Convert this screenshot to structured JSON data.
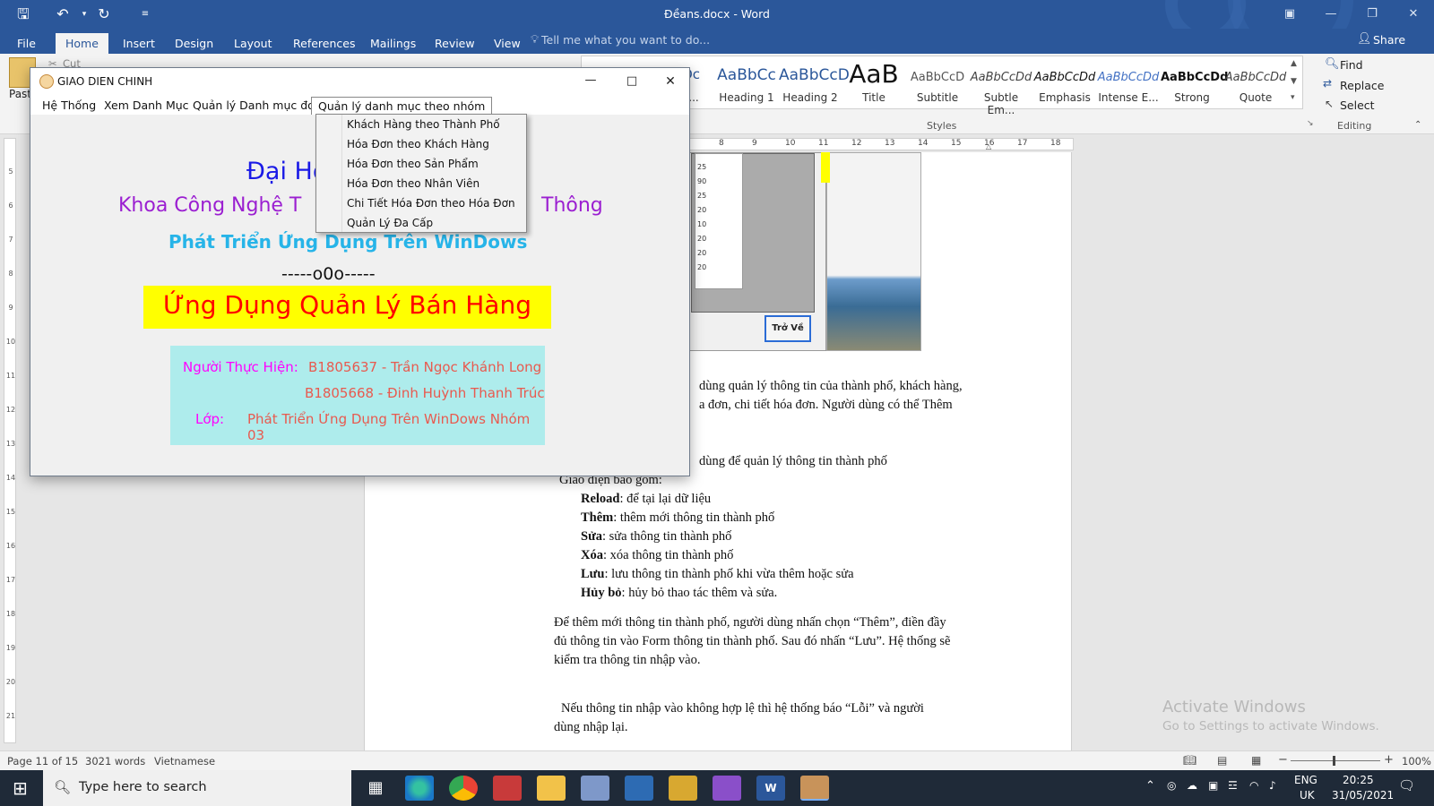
{
  "word": {
    "doc_title": "Đềans.docx - Word",
    "qat": {
      "save_icon": "save-icon",
      "undo_icon": "undo-icon",
      "redo_icon": "redo-icon"
    },
    "tabs": [
      "File",
      "Home",
      "Insert",
      "Design",
      "Layout",
      "References",
      "Mailings",
      "Review",
      "View"
    ],
    "active_tab": "Home",
    "tell_me": "Tell me what you want to do...",
    "share": "Share",
    "clipboard": {
      "cut": "Cut",
      "paste": "Past"
    },
    "styles": [
      {
        "preview": "AaBbCc",
        "label": "Heading 1"
      },
      {
        "preview": "AaBbCcD",
        "label": "Heading 2"
      },
      {
        "preview": "AaB",
        "label": "Title"
      },
      {
        "preview": "AaBbCcD",
        "label": "Subtitle"
      },
      {
        "preview": "AaBbCcDd",
        "label": "Subtle Em..."
      },
      {
        "preview": "AaBbCcDd",
        "label": "Emphasis"
      },
      {
        "preview": "AaBbCcDd",
        "label": "Intense E..."
      },
      {
        "preview": "AaBbCcDd",
        "label": "Strong"
      },
      {
        "preview": "AaBbCcDd",
        "label": "Quote"
      }
    ],
    "styles_partial_preview": "cDc",
    "styles_partial_label": "ac...",
    "styles_group": "Styles",
    "editing": {
      "find": "Find",
      "replace": "Replace",
      "select": "Select",
      "group": "Editing"
    },
    "ruler_numbers": [
      "8",
      "9",
      "10",
      "11",
      "12",
      "13",
      "14",
      "15",
      "16",
      "17",
      "18"
    ],
    "vruler_numbers": [
      "5",
      "6",
      "7",
      "8",
      "9",
      "10",
      "11",
      "12",
      "13",
      "14",
      "15",
      "16",
      "17",
      "18",
      "19",
      "20",
      "21"
    ],
    "embedded_grid_values": [
      "25",
      "90",
      "25",
      "20",
      "10",
      "20",
      "20",
      "20"
    ],
    "embedded_button": "Trở Về",
    "document_lines": [
      "dùng quản lý thông tin của thành phố, khách hàng,",
      "a đơn, chi tiết hóa đơn. Người dùng có thể Thêm",
      "dùng để quản lý thông tin thành phố",
      "Giao diện bao gồm:"
    ],
    "bullets": [
      {
        "term": "Reload",
        "desc": ": để tại lại dữ liệu"
      },
      {
        "term": "Thêm",
        "desc": ": thêm mới thông tin thành phố"
      },
      {
        "term": "Sửa",
        "desc": ": sửa thông tin thành phố"
      },
      {
        "term": "Xóa",
        "desc": ": xóa thông tin thành  phố"
      },
      {
        "term": "Lưu",
        "desc": ": lưu thông tin thành phố khi vừa thêm hoặc sửa"
      },
      {
        "term": "Hủy bỏ",
        "desc": ": hủy bỏ thao tác thêm và sửa."
      }
    ],
    "para1": [
      "Để thêm mới thông tin thành phố, người dùng nhấn chọn “Thêm”,  điền đầy",
      "đủ thông tin vào Form thông tin thành phố. Sau đó nhấn “Lưu”. Hệ thống sẽ",
      "kiểm tra thông tin nhập vào."
    ],
    "para2": [
      "Nếu thông tin nhập vào không hợp lệ thì hệ thống báo “Lỗi” và người",
      "dùng nhập lại."
    ],
    "activate": {
      "title": "Activate Windows",
      "sub": "Go to Settings to activate Windows."
    },
    "status": {
      "page": "Page 11 of 15",
      "words": "3021 words",
      "lang": "Vietnamese",
      "zoom": "100%"
    }
  },
  "app": {
    "title": "GIAO DIEN CHINH",
    "menu": [
      "Hệ Thống",
      "Xem Danh Mục",
      "Quản lý Danh mục đơn",
      "Quản lý danh mục theo nhóm"
    ],
    "dropdown": [
      "Khách Hàng theo Thành Phố",
      "Hóa Đơn theo Khách Hàng",
      "Hóa Đơn theo Sản Phẩm",
      "Hóa Đơn theo Nhân Viên",
      "Chi Tiết Hóa Đơn theo Hóa Đơn",
      "Quản Lý Đa Cấp"
    ],
    "heading1": "Đại Họ",
    "heading2_left": "Khoa Công Nghệ T",
    "heading2_right": "Thông",
    "heading3": "Phát Triển Ứng Dụng Trên WinDows",
    "divider": "-----o0o-----",
    "banner": "Ứng Dụng Quản Lý Bán Hàng",
    "info": {
      "label_performer": "Người Thực Hiện:",
      "member1": "B1805637 - Trần Ngọc Khánh Long",
      "member2": "B1805668 - Đinh Huỳnh Thanh Trúc",
      "label_class": "Lớp:",
      "class_name": "Phát Triển Ứng Dụng Trên WinDows Nhóm 03"
    },
    "colors": {
      "heading1": "#1a1ae6",
      "heading2": "#9b1fd1",
      "heading3": "#27b4e8",
      "banner_bg": "#ffff00",
      "banner_fg": "#ff0000",
      "info_bg": "#aeecec",
      "label": "#ff00ff",
      "value": "#e85a4f"
    }
  },
  "taskbar": {
    "search": "Type here to search",
    "lang": "ENG",
    "region": "UK",
    "time": "20:25",
    "date": "31/05/2021"
  }
}
